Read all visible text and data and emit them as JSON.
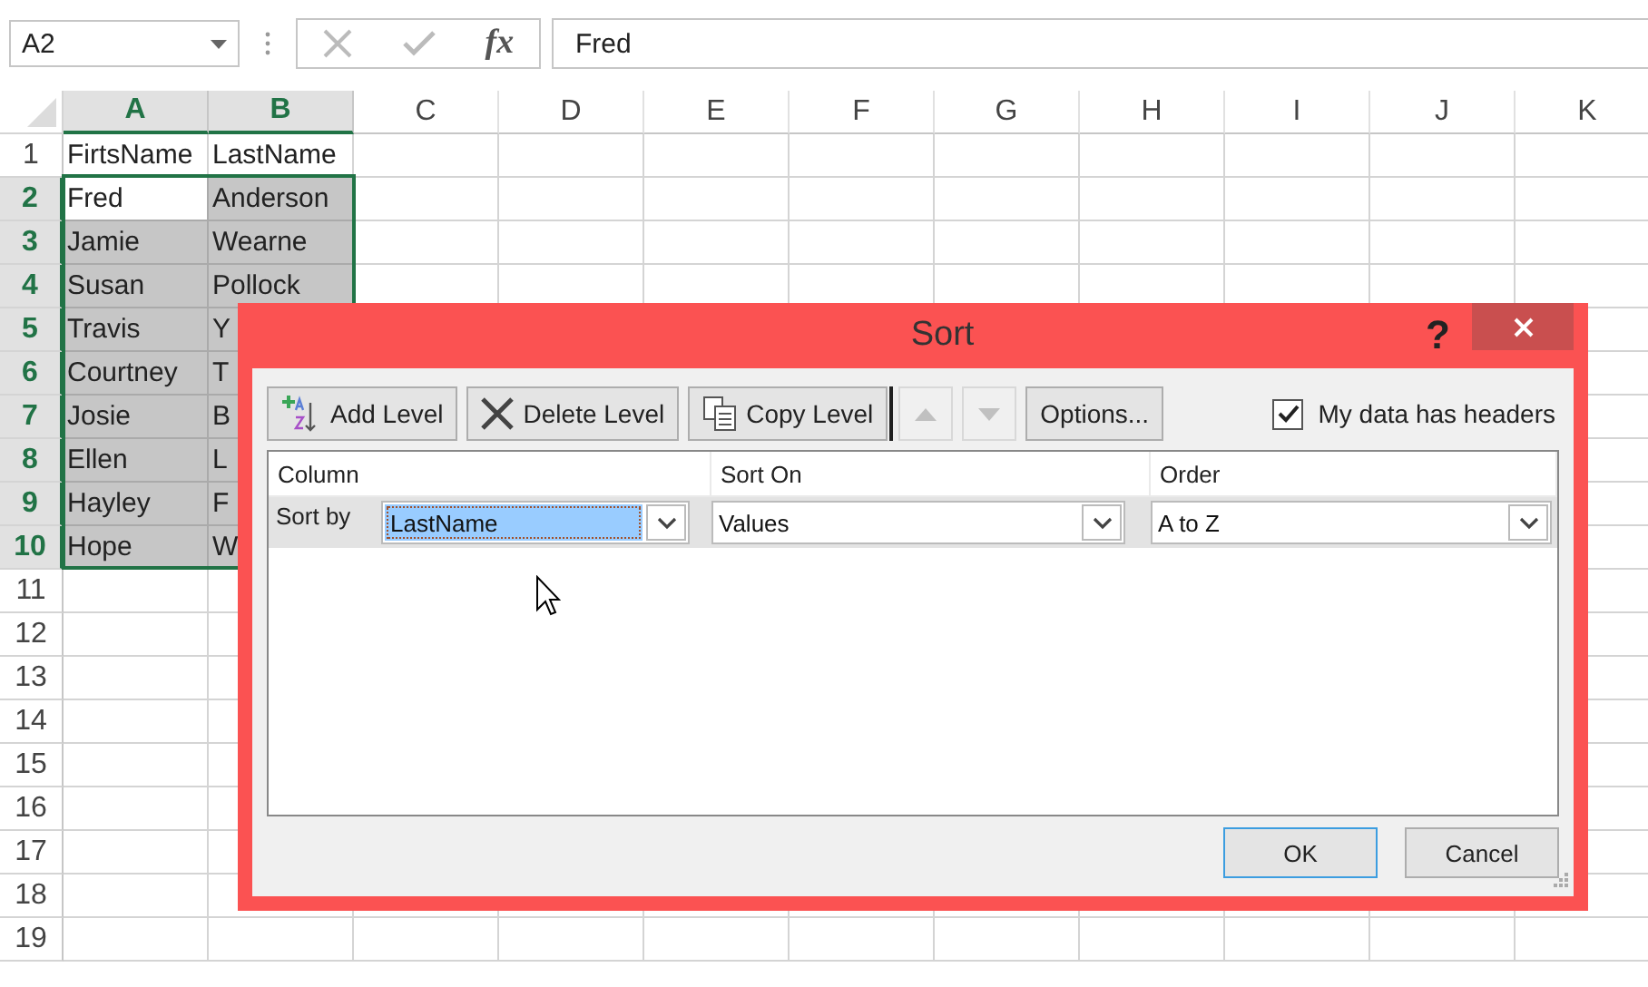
{
  "formula_bar": {
    "name_box": "A2",
    "fx": "fx",
    "value": "Fred"
  },
  "columns": [
    {
      "label": "A",
      "selected": true
    },
    {
      "label": "B",
      "selected": true
    },
    {
      "label": "C",
      "selected": false
    },
    {
      "label": "D",
      "selected": false
    },
    {
      "label": "E",
      "selected": false
    },
    {
      "label": "F",
      "selected": false
    },
    {
      "label": "G",
      "selected": false
    },
    {
      "label": "H",
      "selected": false
    },
    {
      "label": "I",
      "selected": false
    },
    {
      "label": "J",
      "selected": false
    },
    {
      "label": "K",
      "selected": false
    }
  ],
  "rows": [
    {
      "label": "1",
      "selected": false,
      "cells": [
        {
          "text": "FirtsName",
          "selected": false
        },
        {
          "text": "LastName",
          "selected": false
        }
      ]
    },
    {
      "label": "2",
      "selected": true,
      "cells": [
        {
          "text": "Fred",
          "selected": true,
          "active": true
        },
        {
          "text": "Anderson",
          "selected": true,
          "active": false
        }
      ]
    },
    {
      "label": "3",
      "selected": true,
      "cells": [
        {
          "text": "Jamie",
          "selected": true,
          "active": false
        },
        {
          "text": "Wearne",
          "selected": true,
          "active": false
        }
      ]
    },
    {
      "label": "4",
      "selected": true,
      "cells": [
        {
          "text": "Susan",
          "selected": true,
          "active": false
        },
        {
          "text": "Pollock",
          "selected": true,
          "active": false
        }
      ]
    },
    {
      "label": "5",
      "selected": true,
      "cells": [
        {
          "text": "Travis",
          "selected": true,
          "active": false
        },
        {
          "text": "Y",
          "selected": true,
          "active": false
        }
      ]
    },
    {
      "label": "6",
      "selected": true,
      "cells": [
        {
          "text": "Courtney",
          "selected": true,
          "active": false
        },
        {
          "text": "T",
          "selected": true,
          "active": false
        }
      ]
    },
    {
      "label": "7",
      "selected": true,
      "cells": [
        {
          "text": "Josie",
          "selected": true,
          "active": false
        },
        {
          "text": "B",
          "selected": true,
          "active": false
        }
      ]
    },
    {
      "label": "8",
      "selected": true,
      "cells": [
        {
          "text": "Ellen",
          "selected": true,
          "active": false
        },
        {
          "text": "L",
          "selected": true,
          "active": false
        }
      ]
    },
    {
      "label": "9",
      "selected": true,
      "cells": [
        {
          "text": "Hayley",
          "selected": true,
          "active": false
        },
        {
          "text": "F",
          "selected": true,
          "active": false
        }
      ]
    },
    {
      "label": "10",
      "selected": true,
      "cells": [
        {
          "text": "Hope",
          "selected": true,
          "active": false
        },
        {
          "text": "W",
          "selected": true,
          "active": false
        }
      ]
    },
    {
      "label": "11",
      "selected": false,
      "cells": []
    },
    {
      "label": "12",
      "selected": false,
      "cells": []
    },
    {
      "label": "13",
      "selected": false,
      "cells": []
    },
    {
      "label": "14",
      "selected": false,
      "cells": []
    },
    {
      "label": "15",
      "selected": false,
      "cells": []
    },
    {
      "label": "16",
      "selected": false,
      "cells": []
    },
    {
      "label": "17",
      "selected": false,
      "cells": []
    },
    {
      "label": "18",
      "selected": false,
      "cells": []
    },
    {
      "label": "19",
      "selected": false,
      "cells": []
    }
  ],
  "dialog": {
    "title": "Sort",
    "help": "?",
    "toolbar": [
      {
        "kind": "add",
        "label": "Add Level"
      },
      {
        "kind": "delete",
        "label": "Delete Level"
      },
      {
        "kind": "copy",
        "label": "Copy Level"
      },
      {
        "kind": "up",
        "disabled": true
      },
      {
        "kind": "down",
        "disabled": true
      },
      {
        "kind": "plain",
        "label": "Options..."
      }
    ],
    "headers_checkbox": {
      "label": "My data has headers",
      "checked": true
    },
    "columns": [
      "Column",
      "Sort On",
      "Order"
    ],
    "levels": [
      {
        "label": "Sort by",
        "column": {
          "value": "LastName",
          "focused": true
        },
        "sort_on": {
          "value": "Values",
          "focused": false
        },
        "order": {
          "value": "A to Z",
          "focused": false
        }
      }
    ],
    "buttons": [
      {
        "label": "OK",
        "default": true
      },
      {
        "label": "Cancel",
        "default": false
      }
    ]
  }
}
